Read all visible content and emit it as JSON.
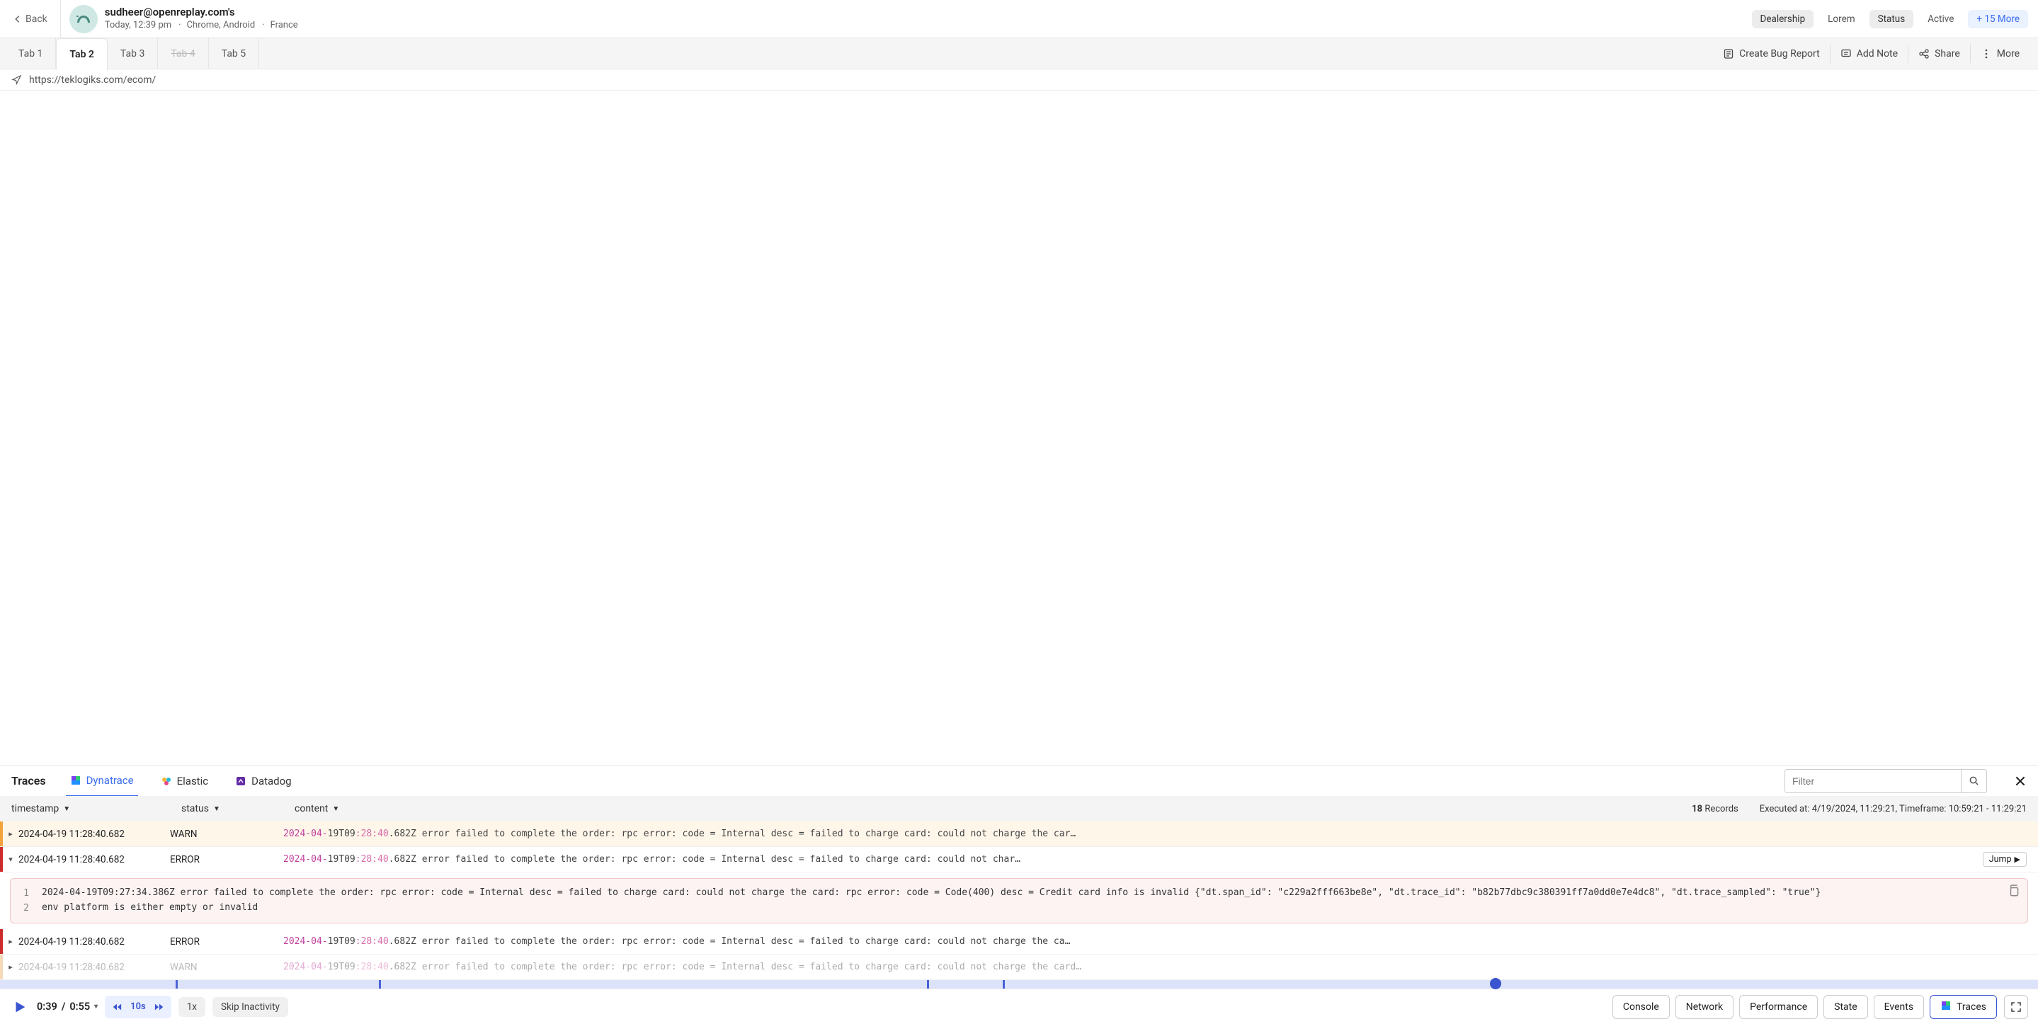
{
  "header": {
    "back_label": "Back",
    "user_title": "sudheer@openreplay.com's",
    "time": "Today, 12:39 pm",
    "browser": "Chrome, Android",
    "country": "France",
    "chips": [
      {
        "label": "Dealership",
        "style": "gray"
      },
      {
        "label": "Lorem",
        "style": "plain"
      },
      {
        "label": "Status",
        "style": "gray"
      },
      {
        "label": "Active",
        "style": "plain"
      },
      {
        "label": "+ 15 More",
        "style": "blue"
      }
    ]
  },
  "tabs": {
    "items": [
      {
        "label": "Tab 1",
        "active": false,
        "disabled": false
      },
      {
        "label": "Tab 2",
        "active": true,
        "disabled": false
      },
      {
        "label": "Tab 3",
        "active": false,
        "disabled": false
      },
      {
        "label": "Tab 4",
        "active": false,
        "disabled": true
      },
      {
        "label": "Tab 5",
        "active": false,
        "disabled": false
      }
    ],
    "actions": {
      "bug": "Create Bug Report",
      "note": "Add Note",
      "share": "Share",
      "more": "More"
    }
  },
  "url": "https://teklogiks.com/ecom/",
  "traces": {
    "title": "Traces",
    "sources": [
      {
        "label": "Dynatrace",
        "active": true
      },
      {
        "label": "Elastic",
        "active": false
      },
      {
        "label": "Datadog",
        "active": false
      }
    ],
    "filter_placeholder": "Filter",
    "columns": {
      "ts": "timestamp",
      "status": "status",
      "content": "content"
    },
    "records_count": "18",
    "records_word": "Records",
    "executed_at": "Executed at: 4/19/2024, 11:29:21, Timeframe: 10:59:21 - 11:29:21",
    "rows": [
      {
        "level": "WARN",
        "ts_display": "2024-04-19 11:28:40.682",
        "content": {
          "date": "2024-04-",
          "mid": "19T09",
          "time": ":28:40",
          "rest": ".682Z error failed to complete the order: rpc error: code = Internal desc = failed to charge card: could not charge the car…"
        },
        "expanded": false,
        "bar": "warn",
        "bg": "warn"
      },
      {
        "level": "ERROR",
        "ts_display": "2024-04-19 11:28:40.682",
        "content": {
          "date": "2024-04-",
          "mid": "19T09",
          "time": ":28:40",
          "rest": ".682Z error failed to complete the order: rpc error: code = Internal desc = failed to charge card: could not char…"
        },
        "expanded": true,
        "show_jump": true,
        "jump_label": "Jump",
        "bar": "error",
        "bg": "plain",
        "details": [
          "2024-04-19T09:27:34.386Z error failed to complete the order: rpc error: code = Internal desc = failed to charge card: could not charge the card: rpc error: code = Code(400) desc = Credit card info is invalid {\"dt.span_id\": \"c229a2fff663be8e\", \"dt.trace_id\": \"b82b77dbc9c380391ff7a0dd0e7e4dc8\", \"dt.trace_sampled\": \"true\"}",
          "env platform is either empty or invalid"
        ]
      },
      {
        "level": "ERROR",
        "ts_display": "2024-04-19 11:28:40.682",
        "content": {
          "date": "2024-04-",
          "mid": "19T09",
          "time": ":28:40",
          "rest": ".682Z error failed to complete the order: rpc error: code = Internal desc = failed to charge card: could not charge the ca…"
        },
        "expanded": false,
        "bar": "error",
        "bg": "plain"
      },
      {
        "level": "WARN",
        "ts_display": "2024-04-19 11:28:40.682",
        "content": {
          "date": "2024-04-",
          "mid": "19T09",
          "time": ":28:40",
          "rest": ".682Z error failed to complete the order: rpc error: code = Internal desc = failed to charge card: could not charge the card…"
        },
        "expanded": false,
        "bar": "warn-light",
        "bg": "plain",
        "dim": true
      }
    ]
  },
  "timeline": {
    "marks_pct": [
      8.6,
      18.6,
      45.5,
      49.2
    ],
    "head_pct": 73.4
  },
  "player": {
    "time_current": "0:39",
    "time_total": "0:55",
    "skip_amount": "10s",
    "speed": "1x",
    "skip_inactivity": "Skip Inactivity",
    "panels": [
      {
        "label": "Console",
        "active": false
      },
      {
        "label": "Network",
        "active": false
      },
      {
        "label": "Performance",
        "active": false
      },
      {
        "label": "State",
        "active": false
      },
      {
        "label": "Events",
        "active": false
      },
      {
        "label": "Traces",
        "active": true,
        "icon": "dynatrace"
      }
    ]
  }
}
